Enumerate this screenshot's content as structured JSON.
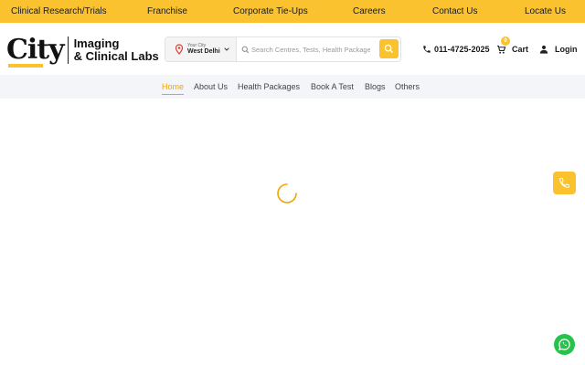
{
  "topbar": {
    "links": [
      "Clinical Research/Trials",
      "Franchise",
      "Corporate Tie-Ups",
      "Careers",
      "Contact Us",
      "Locate Us"
    ]
  },
  "header": {
    "logo": {
      "city": "City",
      "line1": "Imaging",
      "line2": "& Clinical Labs"
    },
    "city_select": {
      "caption": "Your City",
      "value": "West Delhi"
    },
    "search": {
      "placeholder": "Search Centres, Tests, Health Packages"
    },
    "phone": "011-4725-2025",
    "cart": {
      "label": "Cart",
      "count": "0"
    },
    "login": "Login"
  },
  "nav": {
    "items": [
      "Home",
      "About Us",
      "Health Packages",
      "Book A Test",
      "Blogs",
      "Others"
    ],
    "active": "Home"
  },
  "colors": {
    "brand_yellow": "#f9c22e",
    "active_nav": "#f0a500",
    "whatsapp_green": "#27c24c"
  },
  "icons": [
    "map-pin-icon",
    "chevron-down-icon",
    "search-icon",
    "phone-icon",
    "cart-icon",
    "user-icon",
    "loading-spinner-icon",
    "call-icon",
    "whatsapp-icon"
  ]
}
